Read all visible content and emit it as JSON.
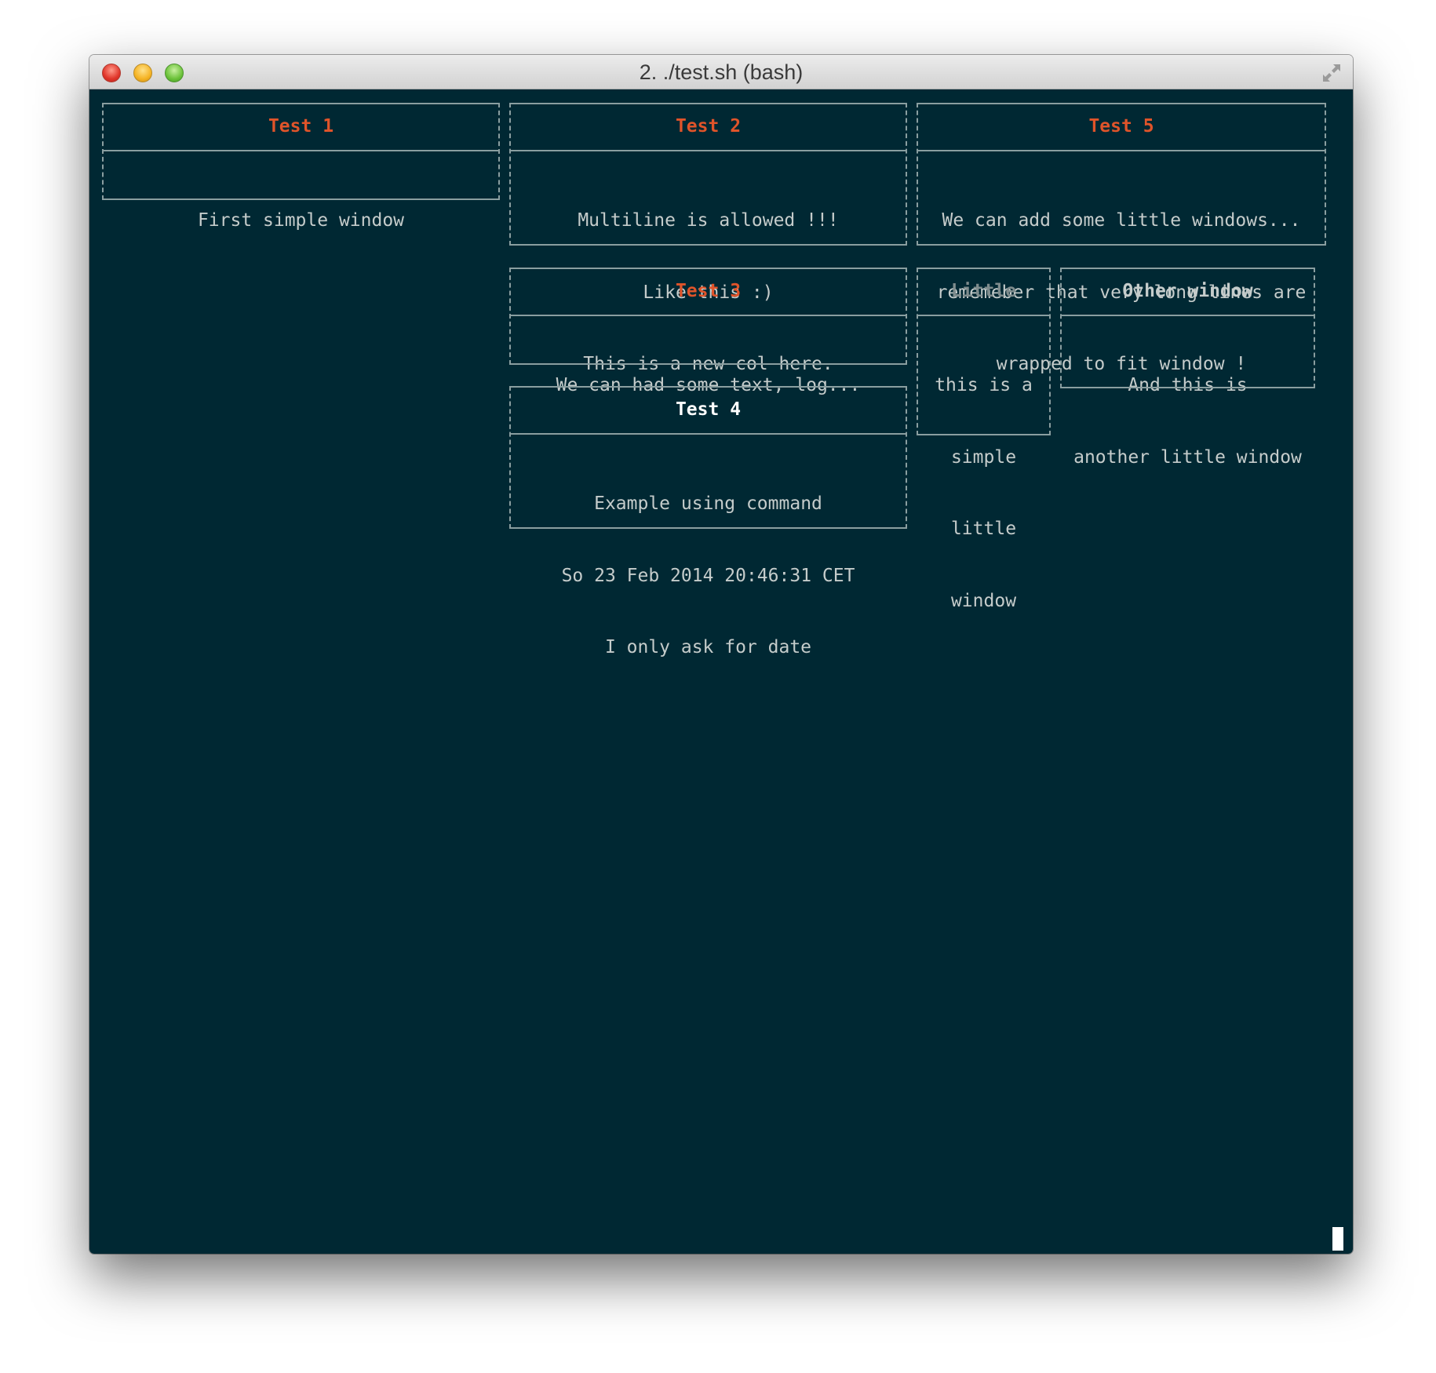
{
  "window": {
    "title": "2. ./test.sh (bash)"
  },
  "colors": {
    "background": "#002833",
    "border": "#8a9ea0",
    "text": "#c5cccb",
    "accent_red": "#e0542a",
    "title_white": "#ffffff",
    "title_gray": "#7f8c8d",
    "title_light": "#c5cccb"
  },
  "icons": {
    "close": "close-icon",
    "minimize": "minimize-icon",
    "zoom": "zoom-icon",
    "fullscreen": "fullscreen-icon"
  },
  "boxes": {
    "test1": {
      "title": "Test 1",
      "lines": [
        "First simple window"
      ]
    },
    "test2": {
      "title": "Test 2",
      "lines": [
        "Multiline is allowed !!!",
        "Like this :)",
        "This is a new col here."
      ]
    },
    "test5": {
      "title": "Test 5",
      "lines": [
        "We can add some little windows...",
        "rememeber that very long lines are",
        "wrapped to fit window !"
      ]
    },
    "test3": {
      "title": "Test 3",
      "lines": [
        "We can had some text, log..."
      ]
    },
    "little": {
      "title": "Little",
      "lines": [
        "this is a",
        "simple",
        "little",
        "window"
      ]
    },
    "other": {
      "title": "Other window",
      "lines": [
        "And this is",
        "another little window"
      ]
    },
    "test4": {
      "title": "Test 4",
      "lines": [
        "Example using command",
        "So 23 Feb 2014 20:46:31 CET",
        "I only ask for date"
      ]
    }
  }
}
